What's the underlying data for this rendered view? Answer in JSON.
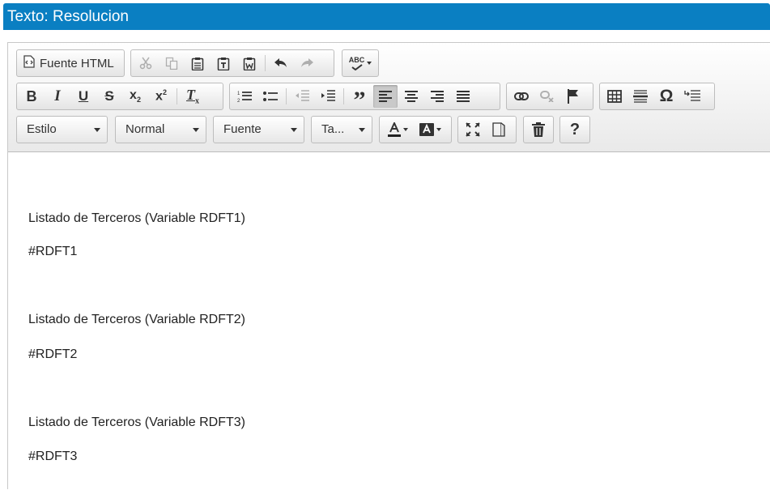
{
  "window": {
    "title": "Texto: Resolucion"
  },
  "toolbar": {
    "source_label": "Fuente HTML",
    "style_combo": "Estilo",
    "format_combo": "Normal",
    "font_combo": "Fuente",
    "size_combo": "Ta...",
    "help_label": "?",
    "spellcheck_label": "ABC",
    "special_char_label": "Ω"
  },
  "content": {
    "paragraphs": [
      "Listado de Terceros (Variable RDFT1)",
      "#RDFT1",
      "Listado de Terceros (Variable RDFT2)",
      "#RDFT2",
      "Listado de Terceros (Variable RDFT3)",
      "#RDFT3"
    ]
  }
}
